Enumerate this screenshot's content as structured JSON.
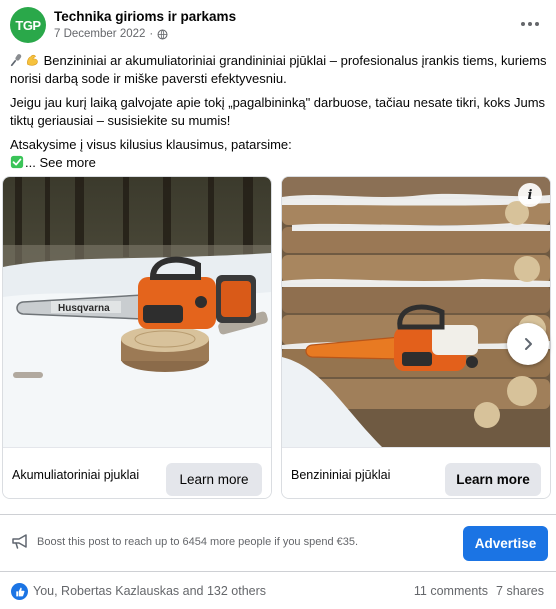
{
  "post": {
    "page_name": "Technika girioms ir parkams",
    "avatar_text": "TGP",
    "date": "7 December 2022",
    "separator": " · ",
    "paragraph_1": "Benzininiai ar akumuliatoriniai grandininiai pjūklai – profesionalus įrankis tiems, kuriems norisi darbą sode ir miške paversti efektyvesniu.",
    "paragraph_2": "Jeigu jau kurį laiką galvojate apie tokį „pagalbininką\" darbuose, tačiau nesate tikri, koks Jums tiktų geriausiai – susisiekite su mumis!",
    "paragraph_3": "Atsakysime į visus kilusius klausimus, patarsime:",
    "see_more": "... See more"
  },
  "carousel": {
    "cards": [
      {
        "title": "Akumuliatoriniai pjuklai",
        "button": "Learn more"
      },
      {
        "title": "Benzininiai pjūklai",
        "button": "Learn more"
      }
    ],
    "brand_label": "Husqvarna"
  },
  "boost": {
    "text": "Boost this post to reach up to 6454 more people if you spend €35.",
    "button": "Advertise"
  },
  "engagement": {
    "reactors": "You, Robertas Kazlauskas and 132 others",
    "comments": "11 comments",
    "shares": "7 shares"
  },
  "colors": {
    "accent": "#1b74e4",
    "brand_green": "#2aa84a",
    "secondary_text": "#65676b"
  },
  "icons": [
    "globe-icon",
    "more-options-icon",
    "microphone-emoji-icon",
    "flexed-biceps-emoji-icon",
    "check-mark-emoji-icon",
    "info-icon",
    "chevron-right-icon",
    "megaphone-icon",
    "like-icon"
  ]
}
